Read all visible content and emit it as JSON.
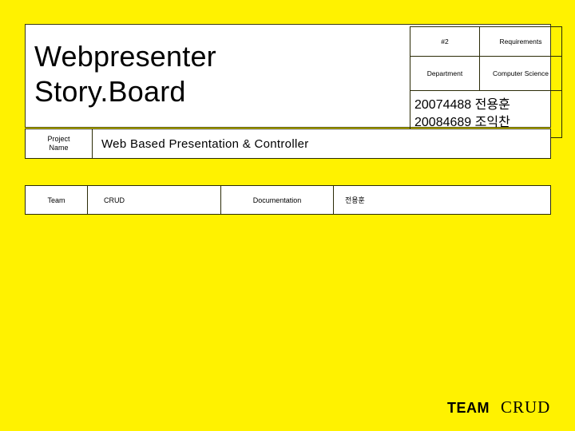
{
  "slide": {
    "background_color": "#FFF200",
    "panel_color": "#FFFFFF",
    "border_color": "#2b2b06"
  },
  "header": {
    "title_line1": "Webpresenter",
    "title_line2": "Story.Board"
  },
  "meta": {
    "doc_number": "#2",
    "doc_type": "Requirements",
    "department_label": "Department",
    "department_value": "Computer Science",
    "members": [
      "20074488 전용훈",
      "20084689 조익찬"
    ]
  },
  "project": {
    "label": "Project Name",
    "label_line1": "Project",
    "label_line2": "Name",
    "value": "Web Based Presentation & Controller"
  },
  "team": {
    "label": "Team",
    "team_name": "CRUD",
    "role": "Documentation",
    "member": "전용훈"
  },
  "footer": {
    "logo_team": "TEAM",
    "logo_crud": "CRUD"
  }
}
